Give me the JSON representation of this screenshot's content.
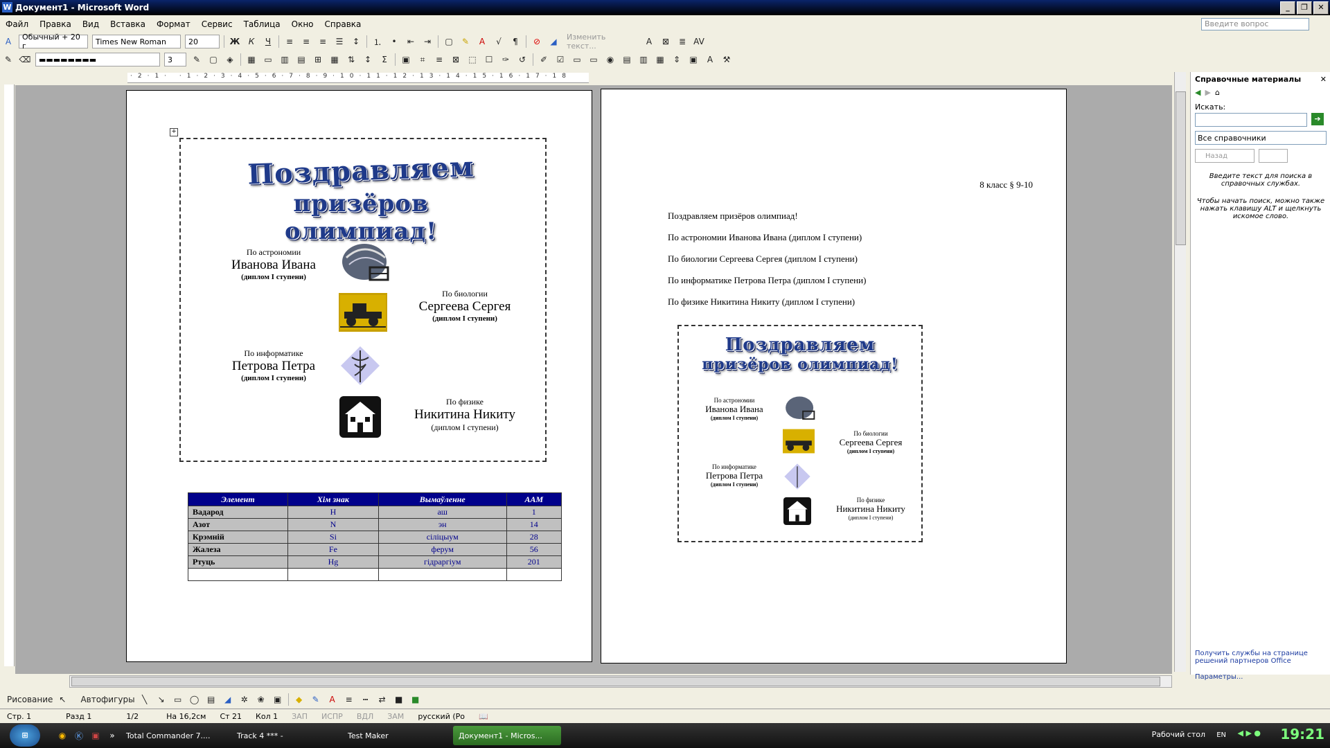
{
  "window": {
    "title": "Документ1 - Microsoft Word"
  },
  "menu": [
    "Файл",
    "Правка",
    "Вид",
    "Вставка",
    "Формат",
    "Сервис",
    "Таблица",
    "Окно",
    "Справка"
  ],
  "ask_placeholder": "Введите вопрос",
  "format_toolbar": {
    "style": "Обычный + 20 г",
    "font": "Times New Roman",
    "size": "20",
    "bold": "Ж",
    "italic": "К",
    "underline": "Ч",
    "change_text": "Изменить текст..."
  },
  "border_toolbar": {
    "line_weight": "3"
  },
  "page1": {
    "wordart_line1": "Поздравляем",
    "wordart_line2": "призёров олимпиад!",
    "awards": [
      {
        "subject": "По астрономии",
        "name": "Иванова Ивана",
        "diploma": "(диплом I ступени)"
      },
      {
        "subject": "По биологии",
        "name": "Сергеева Сергея",
        "diploma": "(диплом I ступени)"
      },
      {
        "subject": "По информатике",
        "name": "Петрова Петра",
        "diploma": "(диплом I ступени)"
      },
      {
        "subject": "По физике",
        "name": "Никитина Никиту",
        "diploma": "(диплом I ступени)"
      }
    ],
    "table": {
      "headers": [
        "Элемент",
        "Хім знак",
        "Вымаўленне",
        "ААМ"
      ],
      "rows": [
        [
          "Вадарод",
          "H",
          "аш",
          "1"
        ],
        [
          "Азот",
          "N",
          "эн",
          "14"
        ],
        [
          "Крэмній",
          "Si",
          "сіліцыум",
          "28"
        ],
        [
          "Жалеза",
          "Fe",
          "ферум",
          "56"
        ],
        [
          "Ртуць",
          "Hg",
          "гідраргіум",
          "201"
        ]
      ]
    }
  },
  "page2": {
    "header_right": "8 класс § 9-10",
    "lines": [
      "Поздравляем призёров олимпиад!",
      "По астрономии Иванова Ивана (диплом I ступени)",
      "По биологии Сергеева Сергея (диплом I ступени)",
      "По информатике Петрова Петра (диплом I ступени)",
      "По физике Никитина Никиту (диплом I ступени)"
    ]
  },
  "taskpane": {
    "title": "Справочные материалы",
    "search_label": "Искать:",
    "source": "Все справочники",
    "back": "Назад",
    "hint1": "Введите текст для поиска в справочных службах.",
    "hint2": "Чтобы начать поиск, можно также нажать клавишу ALT и щелкнуть искомое слово.",
    "link1": "Получить службы на странице решений партнеров Office",
    "link2": "Параметры..."
  },
  "drawbar": {
    "draw": "Рисование",
    "autoshapes": "Автофигуры"
  },
  "status": {
    "page": "Стр. 1",
    "section": "Разд 1",
    "pages": "1/2",
    "at": "На 16,2см",
    "line": "Ст 21",
    "col": "Кол 1",
    "rec": "ЗАП",
    "trk": "ИСПР",
    "ext": "ВДЛ",
    "ovr": "ЗАМ",
    "lang": "русский (Ро"
  },
  "taskbar": {
    "items": [
      "Total Commander 7....",
      "Track  4 *** -",
      "Test Maker",
      "Документ1 - Micros..."
    ],
    "desktop": "Рабочий стол",
    "lang": "EN",
    "time": "19:21"
  }
}
